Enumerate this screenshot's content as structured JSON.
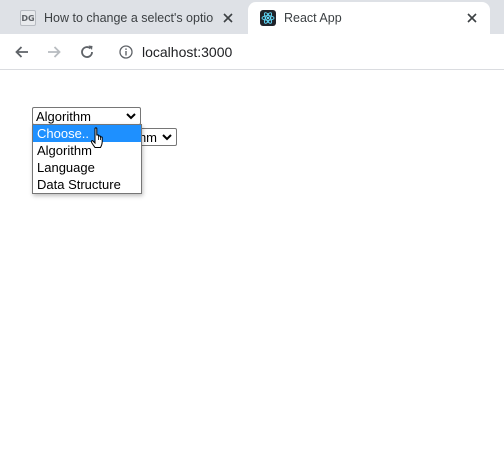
{
  "browser": {
    "tabs": [
      {
        "title": "How to change a select's options",
        "favicon": "gfg-icon",
        "favicon_text": "DG",
        "active": false
      },
      {
        "title": "React App",
        "favicon": "react-icon",
        "active": true
      }
    ],
    "url": "localhost:3000"
  },
  "page": {
    "select1": {
      "value": "Algorithm"
    },
    "select2": {
      "value": "ithm"
    },
    "dropdown": {
      "options": [
        "Choose..",
        "Algorithm",
        "Language",
        "Data Structure"
      ],
      "highlighted_index": 0
    }
  },
  "colors": {
    "highlight": "#1e90ff",
    "tabstrip": "#dee1e6"
  }
}
